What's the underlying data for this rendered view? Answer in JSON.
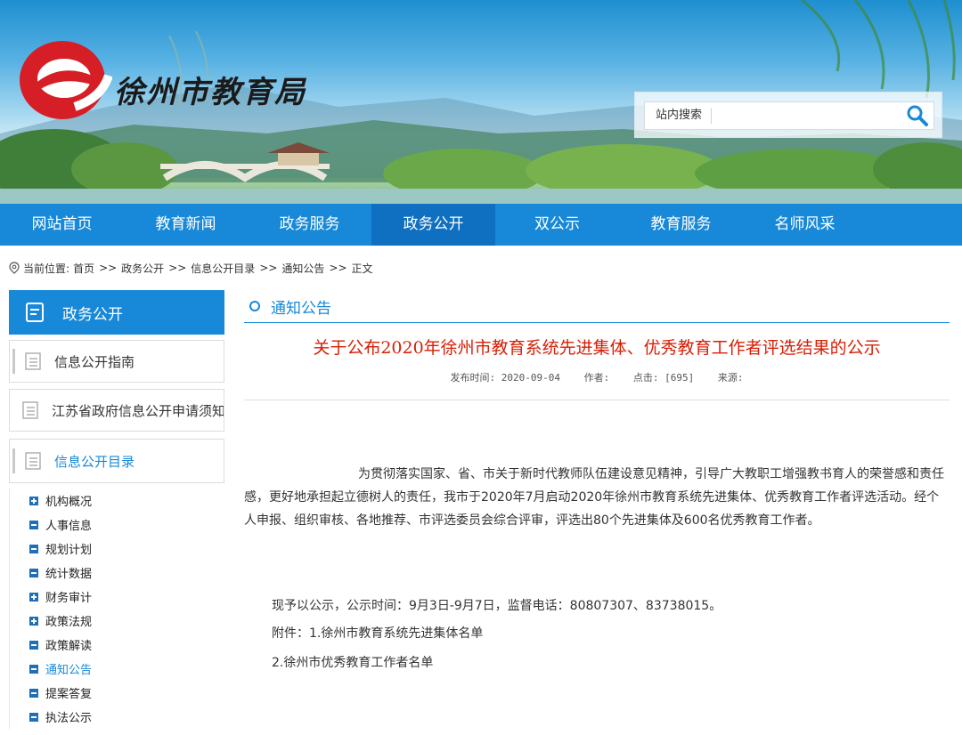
{
  "site": {
    "logo_text": "徐州市教育局",
    "search_label": "站内搜索",
    "search_placeholder": ""
  },
  "nav": {
    "items": [
      "网站首页",
      "教育新闻",
      "政务服务",
      "政务公开",
      "双公示",
      "教育服务",
      "名师风采"
    ],
    "active_index": 3
  },
  "breadcrumb": {
    "prefix": "当前位置:",
    "items": [
      "首页",
      "政务公开",
      "信息公开目录",
      "通知公告",
      "正文"
    ],
    "separator": ">>"
  },
  "sidebar": {
    "header": "政务公开",
    "boxes": [
      "信息公开指南",
      "江苏省政府信息公开申请须知",
      "信息公开目录"
    ],
    "tree": [
      {
        "label": "机构概况",
        "icon": "plus"
      },
      {
        "label": "人事信息",
        "icon": "minus"
      },
      {
        "label": "规划计划",
        "icon": "minus"
      },
      {
        "label": "统计数据",
        "icon": "minus"
      },
      {
        "label": "财务审计",
        "icon": "plus"
      },
      {
        "label": "政策法规",
        "icon": "plus"
      },
      {
        "label": "政策解读",
        "icon": "minus"
      },
      {
        "label": "通知公告",
        "icon": "minus"
      },
      {
        "label": "提案答复",
        "icon": "minus"
      },
      {
        "label": "执法公示",
        "icon": "minus"
      }
    ],
    "current": "通知公告"
  },
  "section": {
    "title": "通知公告"
  },
  "article": {
    "title": "关于公布2020年徐州市教育系统先进集体、优秀教育工作者评选结果的公示",
    "meta_date": "发布时间: 2020-09-04",
    "meta_author": "作者:",
    "meta_clicks": "点击: [695]",
    "meta_source": "来源:",
    "body": "为贯彻落实国家、省、市关于新时代教师队伍建设意见精神，引导广大教职工增强教书育人的荣誉感和责任感，更好地承担起立德树人的责任，我市于2020年7月启动2020年徐州市教育系统先进集体、优秀教育工作者评选活动。经个人申报、组织审核、各地推荐、市评选委员会综合评审，评选出80个先进集体及600名优秀教育工作者。",
    "p2": "现予以公示，公示时间：9月3日-9月7日，监督电话：80807307、83738015。",
    "p3": "附件：1.徐州市教育系统先进集体名单",
    "p4": "2.徐州市优秀教育工作者名单"
  },
  "colors": {
    "nav_blue": "#1789d8",
    "nav_active": "#0f6fc0",
    "title_red": "#d81e06"
  }
}
